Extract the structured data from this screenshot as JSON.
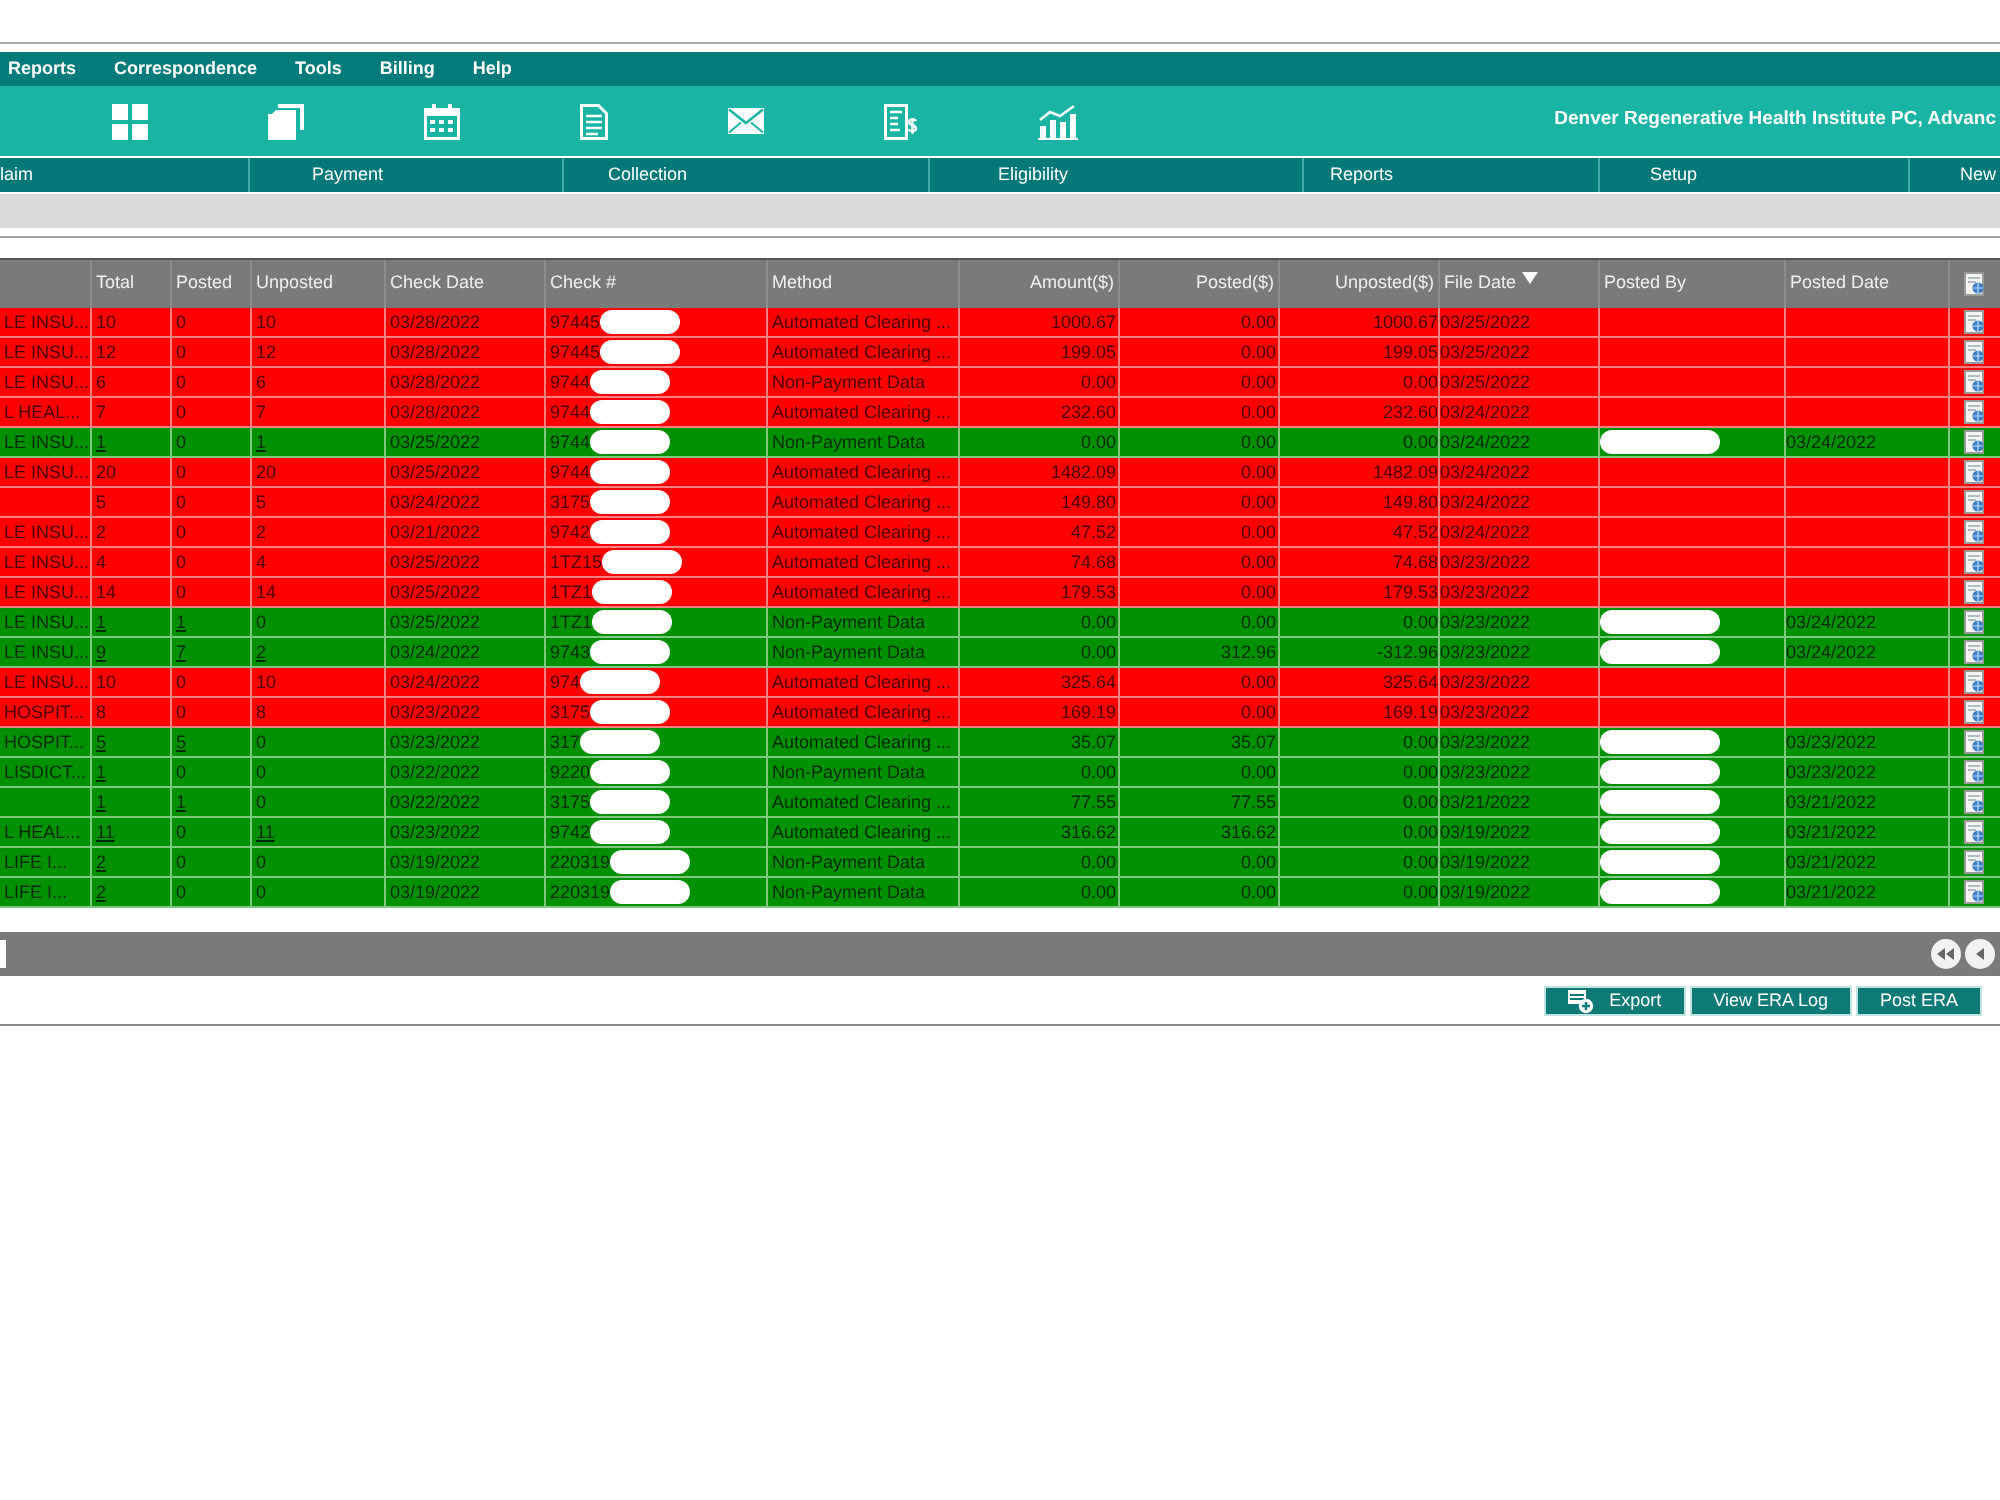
{
  "menu_bar": {
    "items": [
      "Reports",
      "Correspondence",
      "Tools",
      "Billing",
      "Help"
    ]
  },
  "toolbar": {
    "organization": "Denver Regenerative Health Institute PC, Advanc"
  },
  "nav_tabs": [
    "laim",
    "Payment",
    "Collection",
    "Eligibility",
    "Reports",
    "Setup",
    "New"
  ],
  "table": {
    "columns": [
      {
        "label": "Total",
        "sorted": false
      },
      {
        "label": "Posted",
        "sorted": false
      },
      {
        "label": "Unposted",
        "sorted": false
      },
      {
        "label": "Check Date",
        "sorted": false
      },
      {
        "label": "Check #",
        "sorted": false
      },
      {
        "label": "Method",
        "sorted": false
      },
      {
        "label": "Amount($)",
        "sorted": false
      },
      {
        "label": "Posted($)",
        "sorted": false
      },
      {
        "label": "Unposted($)",
        "sorted": false
      },
      {
        "label": "File Date",
        "sorted": true
      },
      {
        "label": "Posted By",
        "sorted": false
      },
      {
        "label": "Posted Date",
        "sorted": false
      }
    ],
    "rows": [
      {
        "color": "#ff0000",
        "column_1": "LE INSU...",
        "total": {
          "text": "10",
          "link": false
        },
        "posted": {
          "text": "0",
          "link": false
        },
        "unposted": {
          "text": "10",
          "link": false
        },
        "check_date": "03/28/2022",
        "check_number": "97445",
        "method": "Automated Clearing ...",
        "amount": "1000.67",
        "posted_amount": "0.00",
        "unposted_amount": "1000.67",
        "file_date": "03/25/2022",
        "posted_by_hidden": false
      },
      {
        "color": "#ff0000",
        "column_1": "LE INSU...",
        "total": {
          "text": "12",
          "link": false
        },
        "posted": {
          "text": "0",
          "link": false
        },
        "unposted": {
          "text": "12",
          "link": false
        },
        "check_date": "03/28/2022",
        "check_number": "97445",
        "method": "Automated Clearing ...",
        "amount": "199.05",
        "posted_amount": "0.00",
        "unposted_amount": "199.05",
        "file_date": "03/25/2022",
        "posted_by_hidden": false
      },
      {
        "color": "#ff0000",
        "column_1": "LE INSU...",
        "total": {
          "text": "6",
          "link": false
        },
        "posted": {
          "text": "0",
          "link": false
        },
        "unposted": {
          "text": "6",
          "link": false
        },
        "check_date": "03/28/2022",
        "check_number": "9744",
        "method": "Non-Payment Data",
        "amount": "0.00",
        "posted_amount": "0.00",
        "unposted_amount": "0.00",
        "file_date": "03/25/2022",
        "posted_by_hidden": false
      },
      {
        "color": "#ff0000",
        "column_1": "L HEAL...",
        "total": {
          "text": "7",
          "link": false
        },
        "posted": {
          "text": "0",
          "link": false
        },
        "unposted": {
          "text": "7",
          "link": false
        },
        "check_date": "03/28/2022",
        "check_number": "9744",
        "method": "Automated Clearing ...",
        "amount": "232.60",
        "posted_amount": "0.00",
        "unposted_amount": "232.60",
        "file_date": "03/24/2022",
        "posted_by_hidden": false
      },
      {
        "color": "#009000",
        "column_1": "LE INSU...",
        "total": {
          "text": "1",
          "link": true
        },
        "posted": {
          "text": "0",
          "link": false
        },
        "unposted": {
          "text": "1",
          "link": true
        },
        "check_date": "03/25/2022",
        "check_number": "9744",
        "method": "Non-Payment Data",
        "amount": "0.00",
        "posted_amount": "0.00",
        "unposted_amount": "0.00",
        "file_date": "03/24/2022",
        "posted_by_hidden": true,
        "posted_date": "03/24/2022"
      },
      {
        "color": "#ff0000",
        "column_1": "LE INSU...",
        "total": {
          "text": "20",
          "link": false
        },
        "posted": {
          "text": "0",
          "link": false
        },
        "unposted": {
          "text": "20",
          "link": false
        },
        "check_date": "03/25/2022",
        "check_number": "9744",
        "method": "Automated Clearing ...",
        "amount": "1482.09",
        "posted_amount": "0.00",
        "unposted_amount": "1482.09",
        "file_date": "03/24/2022",
        "posted_by_hidden": false
      },
      {
        "color": "#ff0000",
        "total": {
          "text": "5",
          "link": false
        },
        "posted": {
          "text": "0",
          "link": false
        },
        "unposted": {
          "text": "5",
          "link": false
        },
        "check_date": "03/24/2022",
        "check_number": "3175",
        "method": "Automated Clearing ...",
        "amount": "149.80",
        "posted_amount": "0.00",
        "unposted_amount": "149.80",
        "file_date": "03/24/2022",
        "posted_by_hidden": false
      },
      {
        "color": "#ff0000",
        "column_1": "LE INSU...",
        "total": {
          "text": "2",
          "link": false
        },
        "posted": {
          "text": "0",
          "link": false
        },
        "unposted": {
          "text": "2",
          "link": false
        },
        "check_date": "03/21/2022",
        "check_number": "9742",
        "method": "Automated Clearing ...",
        "amount": "47.52",
        "posted_amount": "0.00",
        "unposted_amount": "47.52",
        "file_date": "03/24/2022",
        "posted_by_hidden": false
      },
      {
        "color": "#ff0000",
        "column_1": "LE INSU...",
        "total": {
          "text": "4",
          "link": false
        },
        "posted": {
          "text": "0",
          "link": false
        },
        "unposted": {
          "text": "4",
          "link": false
        },
        "check_date": "03/25/2022",
        "check_number": "1TZ15",
        "method": "Automated Clearing ...",
        "amount": "74.68",
        "posted_amount": "0.00",
        "unposted_amount": "74.68",
        "file_date": "03/23/2022",
        "posted_by_hidden": false
      },
      {
        "color": "#ff0000",
        "column_1": "LE INSU...",
        "total": {
          "text": "14",
          "link": false
        },
        "posted": {
          "text": "0",
          "link": false
        },
        "unposted": {
          "text": "14",
          "link": false
        },
        "check_date": "03/25/2022",
        "check_number": "1TZ1",
        "method": "Automated Clearing ...",
        "amount": "179.53",
        "posted_amount": "0.00",
        "unposted_amount": "179.53",
        "file_date": "03/23/2022",
        "posted_by_hidden": false
      },
      {
        "color": "#009000",
        "column_1": "LE INSU...",
        "total": {
          "text": "1",
          "link": true
        },
        "posted": {
          "text": "1",
          "link": true
        },
        "unposted": {
          "text": "0",
          "link": false
        },
        "check_date": "03/25/2022",
        "check_number": "1TZ1",
        "method": "Non-Payment Data",
        "amount": "0.00",
        "posted_amount": "0.00",
        "unposted_amount": "0.00",
        "file_date": "03/23/2022",
        "posted_by_hidden": true,
        "posted_date": "03/24/2022"
      },
      {
        "color": "#009000",
        "column_1": "LE INSU...",
        "total": {
          "text": "9",
          "link": true
        },
        "posted": {
          "text": "7",
          "link": true
        },
        "unposted": {
          "text": "2",
          "link": true
        },
        "check_date": "03/24/2022",
        "check_number": "9743",
        "method": "Non-Payment Data",
        "amount": "0.00",
        "posted_amount": "312.96",
        "unposted_amount": "-312.96",
        "file_date": "03/23/2022",
        "posted_by_hidden": true,
        "posted_date": "03/24/2022"
      },
      {
        "color": "#ff0000",
        "column_1": "LE INSU...",
        "total": {
          "text": "10",
          "link": false
        },
        "posted": {
          "text": "0",
          "link": false
        },
        "unposted": {
          "text": "10",
          "link": false
        },
        "check_date": "03/24/2022",
        "check_number": "974",
        "method": "Automated Clearing ...",
        "amount": "325.64",
        "posted_amount": "0.00",
        "unposted_amount": "325.64",
        "file_date": "03/23/2022",
        "posted_by_hidden": false
      },
      {
        "color": "#ff0000",
        "column_1": "HOSPIT...",
        "total": {
          "text": "8",
          "link": false
        },
        "posted": {
          "text": "0",
          "link": false
        },
        "unposted": {
          "text": "8",
          "link": false
        },
        "check_date": "03/23/2022",
        "check_number": "3175",
        "method": "Automated Clearing ...",
        "amount": "169.19",
        "posted_amount": "0.00",
        "unposted_amount": "169.19",
        "file_date": "03/23/2022",
        "posted_by_hidden": false
      },
      {
        "color": "#009000",
        "column_1": "HOSPIT...",
        "total": {
          "text": "5",
          "link": true
        },
        "posted": {
          "text": "5",
          "link": true
        },
        "unposted": {
          "text": "0",
          "link": false
        },
        "check_date": "03/23/2022",
        "check_number": "317",
        "method": "Automated Clearing ...",
        "amount": "35.07",
        "posted_amount": "35.07",
        "unposted_amount": "0.00",
        "file_date": "03/23/2022",
        "posted_by_hidden": true,
        "posted_date": "03/23/2022"
      },
      {
        "color": "#009000",
        "column_1": "LISDICT...",
        "total": {
          "text": "1",
          "link": true
        },
        "posted": {
          "text": "0",
          "link": false
        },
        "unposted": {
          "text": "0",
          "link": false
        },
        "check_date": "03/22/2022",
        "check_number": "9220",
        "method": "Non-Payment Data",
        "amount": "0.00",
        "posted_amount": "0.00",
        "unposted_amount": "0.00",
        "file_date": "03/23/2022",
        "posted_by_hidden": true,
        "posted_date": "03/23/2022"
      },
      {
        "color": "#009000",
        "total": {
          "text": "1",
          "link": true
        },
        "posted": {
          "text": "1",
          "link": true
        },
        "unposted": {
          "text": "0",
          "link": false
        },
        "check_date": "03/22/2022",
        "check_number": "3175",
        "method": "Automated Clearing ...",
        "amount": "77.55",
        "posted_amount": "77.55",
        "unposted_amount": "0.00",
        "file_date": "03/21/2022",
        "posted_by_hidden": true,
        "posted_date": "03/21/2022"
      },
      {
        "color": "#009000",
        "column_1": "L HEAL...",
        "total": {
          "text": "11",
          "link": true
        },
        "posted": {
          "text": "0",
          "link": false
        },
        "unposted": {
          "text": "11",
          "link": true
        },
        "check_date": "03/23/2022",
        "check_number": "9742",
        "method": "Automated Clearing ...",
        "amount": "316.62",
        "posted_amount": "316.62",
        "unposted_amount": "0.00",
        "file_date": "03/19/2022",
        "posted_by_hidden": true,
        "posted_date": "03/21/2022"
      },
      {
        "color": "#009000",
        "column_1": "LIFE I...",
        "total": {
          "text": "2",
          "link": true
        },
        "posted": {
          "text": "0",
          "link": false
        },
        "unposted": {
          "text": "0",
          "link": false
        },
        "check_date": "03/19/2022",
        "check_number": "220319",
        "method": "Non-Payment Data",
        "amount": "0.00",
        "posted_amount": "0.00",
        "unposted_amount": "0.00",
        "file_date": "03/19/2022",
        "posted_by_hidden": true,
        "posted_date": "03/21/2022"
      },
      {
        "color": "#009000",
        "column_1": "LIFE I...",
        "total": {
          "text": "2",
          "link": true
        },
        "posted": {
          "text": "0",
          "link": false
        },
        "unposted": {
          "text": "0",
          "link": false
        },
        "check_date": "03/19/2022",
        "check_number": "220319",
        "method": "Non-Payment Data",
        "amount": "0.00",
        "posted_amount": "0.00",
        "unposted_amount": "0.00",
        "file_date": "03/19/2022",
        "posted_by_hidden": true,
        "posted_date": "03/21/2022"
      }
    ]
  },
  "buttons": [
    {
      "label": "Export",
      "kind": "export"
    },
    {
      "label": "View ERA Log",
      "kind": "plain"
    },
    {
      "label": "Post ERA",
      "kind": "plain"
    }
  ]
}
